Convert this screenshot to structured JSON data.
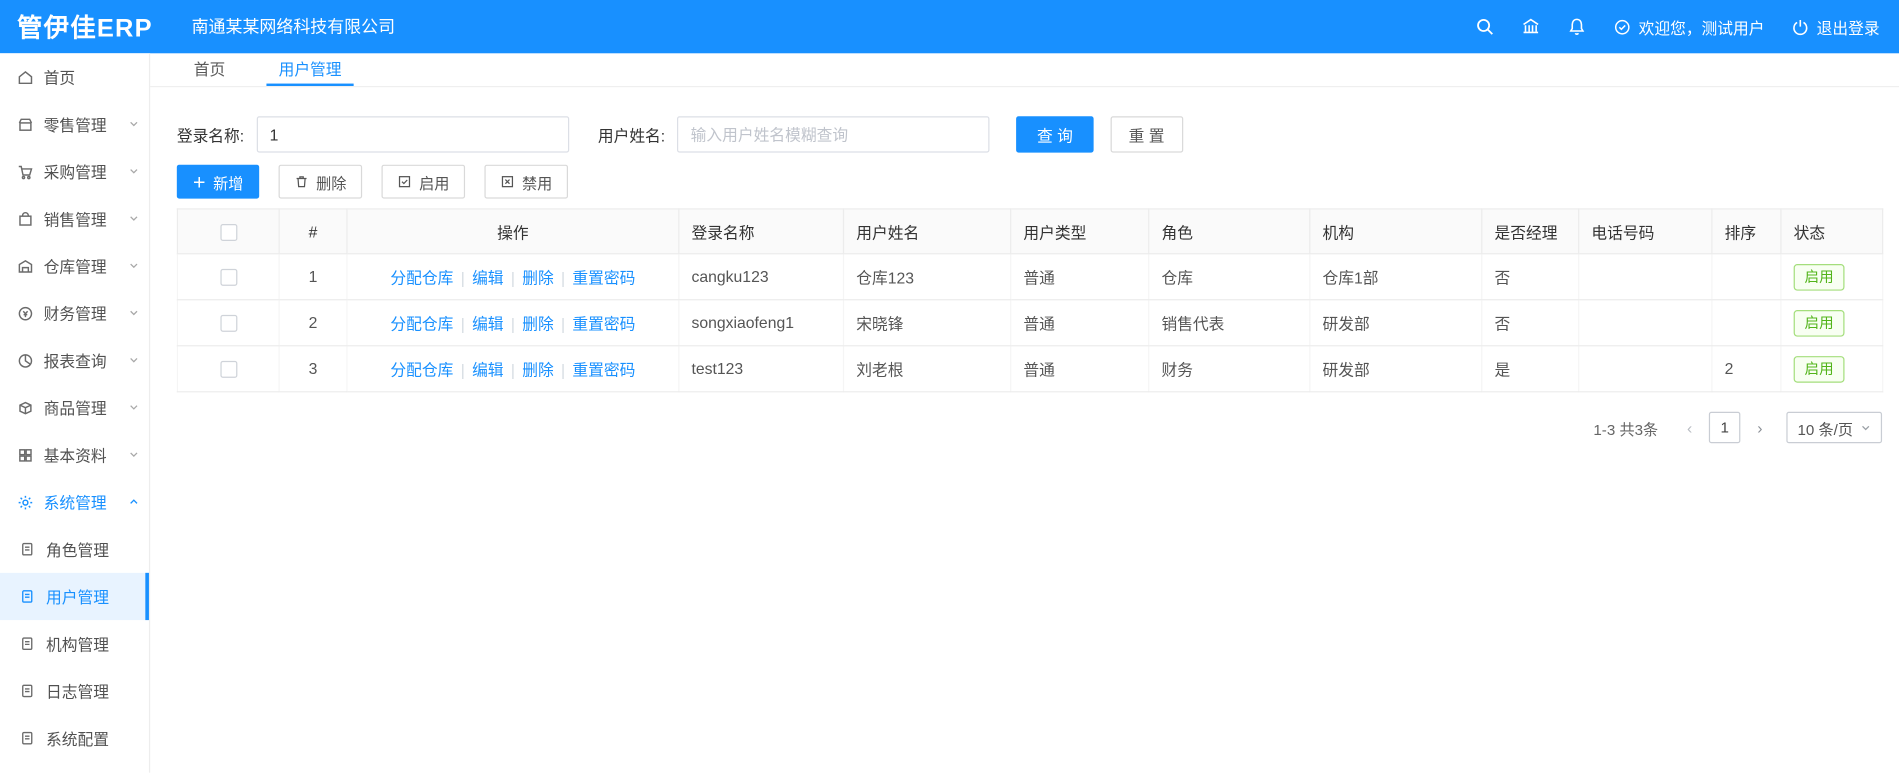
{
  "colors": {
    "primary": "#1890ff",
    "success": "#52c41a"
  },
  "header": {
    "logo": "管伊佳ERP",
    "company": "南通某某网络科技有限公司",
    "welcome": "欢迎您，测试用户",
    "logout": "退出登录"
  },
  "sidebar": {
    "items": [
      {
        "label": "首页"
      },
      {
        "label": "零售管理"
      },
      {
        "label": "采购管理"
      },
      {
        "label": "销售管理"
      },
      {
        "label": "仓库管理"
      },
      {
        "label": "财务管理"
      },
      {
        "label": "报表查询"
      },
      {
        "label": "商品管理"
      },
      {
        "label": "基本资料"
      },
      {
        "label": "系统管理"
      }
    ],
    "submenu": [
      {
        "label": "角色管理"
      },
      {
        "label": "用户管理"
      },
      {
        "label": "机构管理"
      },
      {
        "label": "日志管理"
      },
      {
        "label": "系统配置"
      }
    ]
  },
  "tabs": [
    {
      "label": "首页"
    },
    {
      "label": "用户管理"
    }
  ],
  "search": {
    "login_label": "登录名称:",
    "login_value": "1",
    "name_label": "用户姓名:",
    "name_placeholder": "输入用户姓名模糊查询",
    "query_label": "查 询",
    "reset_label": "重 置"
  },
  "toolbar": {
    "add_label": "新增",
    "delete_label": "删除",
    "enable_label": "启用",
    "disable_label": "禁用"
  },
  "table": {
    "headers": [
      "#",
      "操作",
      "登录名称",
      "用户姓名",
      "用户类型",
      "角色",
      "机构",
      "是否经理",
      "电话号码",
      "排序",
      "状态"
    ],
    "actions": [
      "分配仓库",
      "编辑",
      "删除",
      "重置密码"
    ],
    "rows": [
      {
        "num": "1",
        "login": "cangku123",
        "name": "仓库123",
        "type": "普通",
        "role": "仓库",
        "org": "仓库1部",
        "manager": "否",
        "phone": "",
        "sort": "",
        "status": "启用"
      },
      {
        "num": "2",
        "login": "songxiaofeng1",
        "name": "宋晓锋",
        "type": "普通",
        "role": "销售代表",
        "org": "研发部",
        "manager": "否",
        "phone": "",
        "sort": "",
        "status": "启用"
      },
      {
        "num": "3",
        "login": "test123",
        "name": "刘老根",
        "type": "普通",
        "role": "财务",
        "org": "研发部",
        "manager": "是",
        "phone": "",
        "sort": "2",
        "status": "启用"
      }
    ]
  },
  "pagination": {
    "total": "1-3 共3条",
    "prev": "‹",
    "next": "›",
    "current_page": "1",
    "page_size": "10 条/页"
  }
}
